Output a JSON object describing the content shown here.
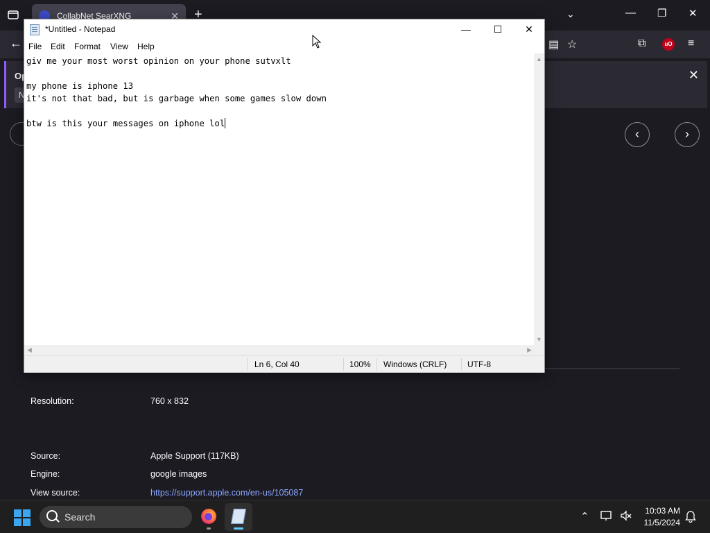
{
  "browser": {
    "tab_title": "CollabNet SearXNG",
    "notification_label": "Op",
    "notification_button": "N",
    "details": {
      "resolution_label": "Resolution:",
      "resolution_value": "760 x 832",
      "source_label": "Source:",
      "source_value": "Apple Support (117KB)",
      "engine_label": "Engine:",
      "engine_value": "google images",
      "view_source_label": "View source:",
      "view_source_value": "https://support.apple.com/en-us/105087"
    }
  },
  "notepad": {
    "title": "*Untitled - Notepad",
    "menu": [
      "File",
      "Edit",
      "Format",
      "View",
      "Help"
    ],
    "lines": [
      "giv me your most worst opinion on your phone sutvxlt",
      "",
      "my phone is iphone 13",
      "it's not that bad, but is garbage when some games slow down",
      "",
      "btw is this your messages on iphone lol"
    ],
    "status": {
      "position": "Ln 6, Col 40",
      "zoom": "100%",
      "line_ending": "Windows (CRLF)",
      "encoding": "UTF-8"
    }
  },
  "taskbar": {
    "search_placeholder": "Search",
    "time": "10:03 AM",
    "date": "11/5/2024"
  }
}
